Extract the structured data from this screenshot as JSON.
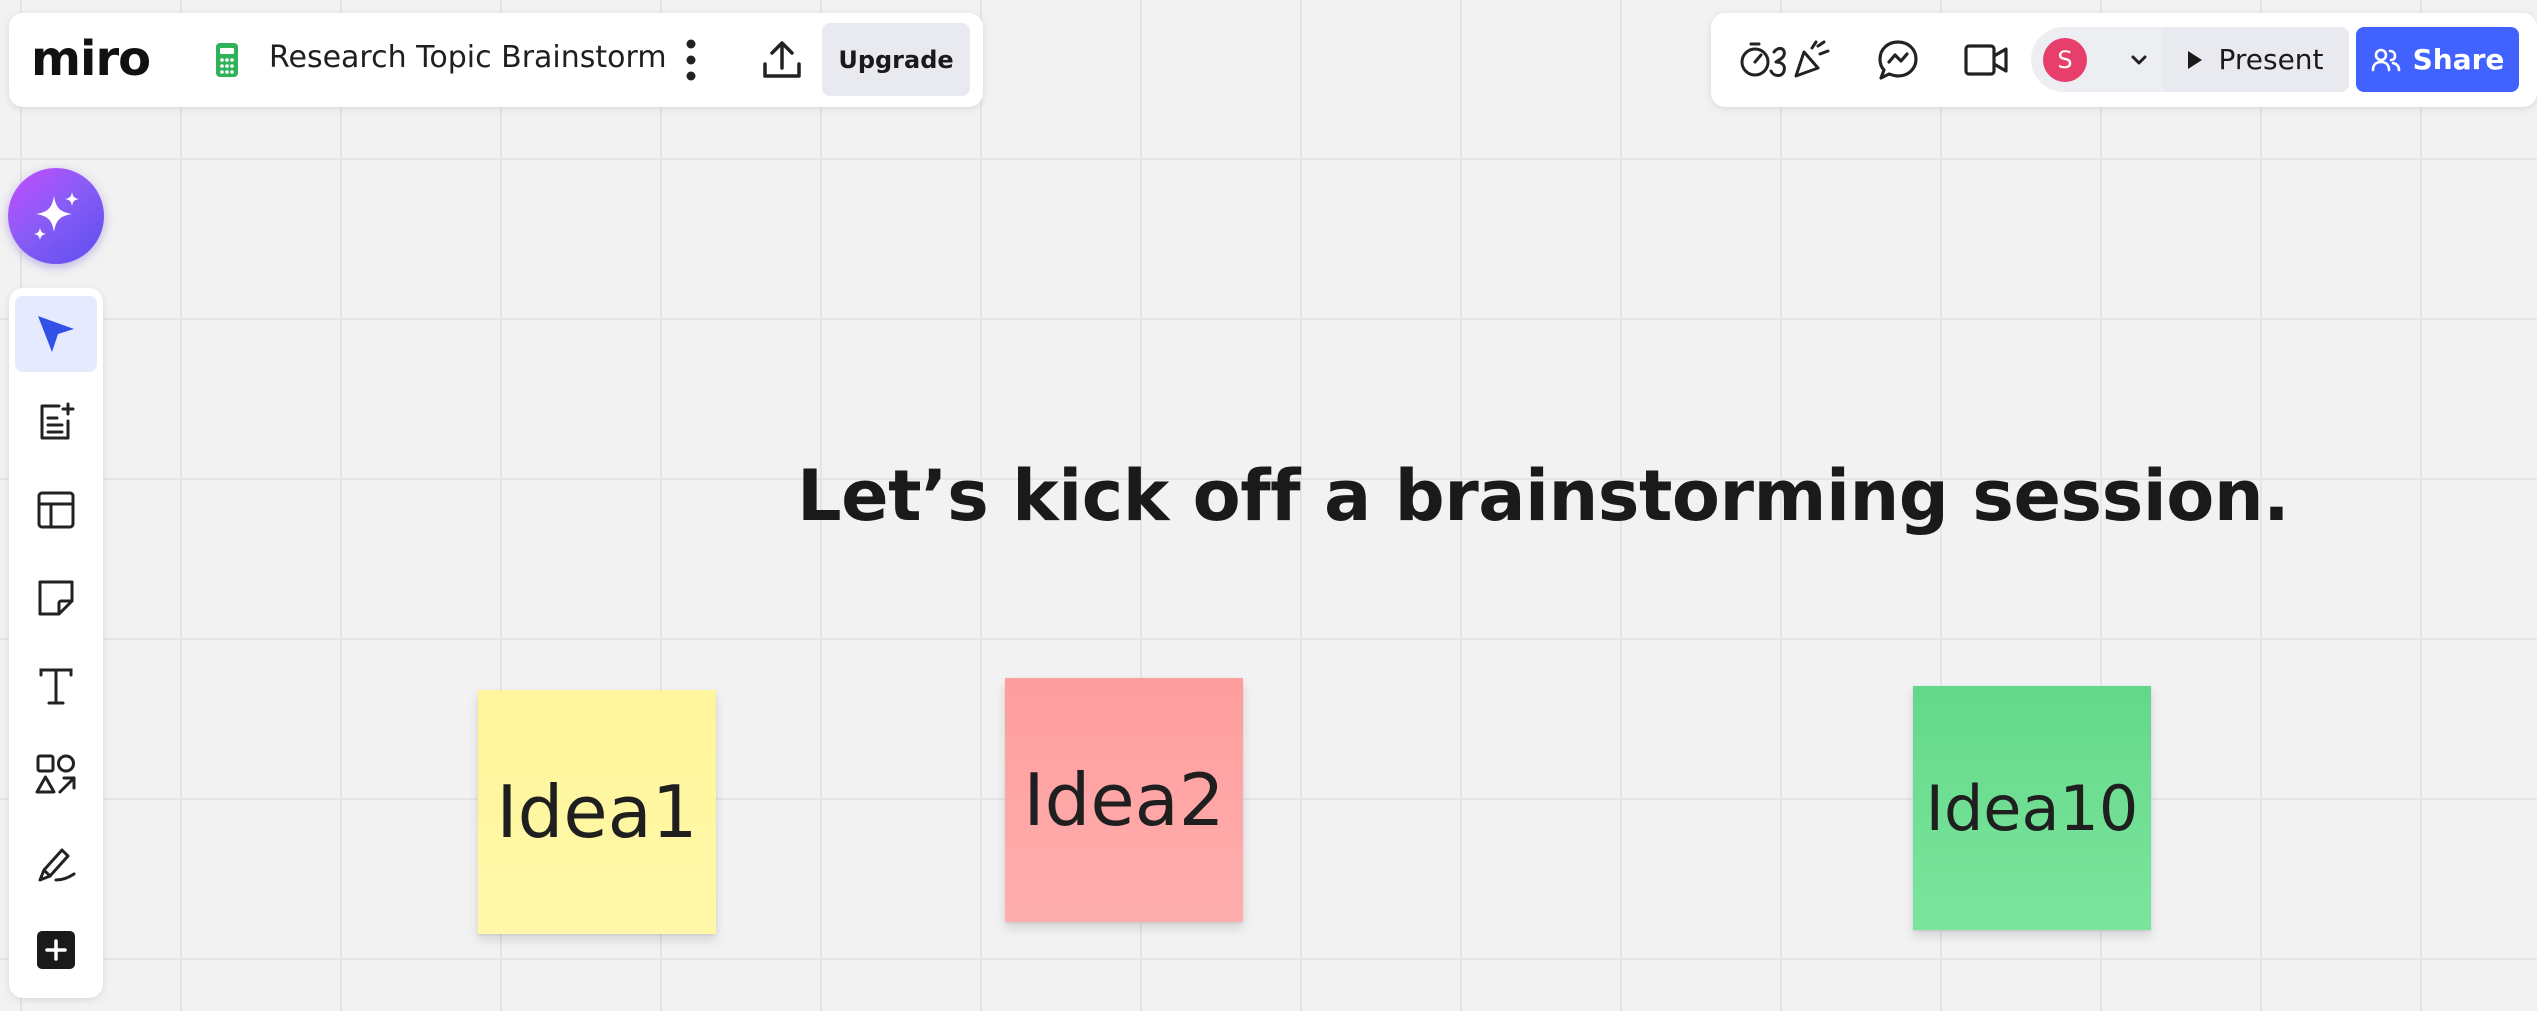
{
  "app": {
    "logo": "miro",
    "board_title": "Research Topic Brainstorm"
  },
  "toolbar_top": {
    "upgrade_label": "Upgrade",
    "present_label": "Present",
    "share_label": "Share",
    "avatar_initial": "S",
    "icons": [
      "board-icon",
      "more-vertical-icon",
      "export-icon",
      "timer-reactions-icon",
      "chat-icon",
      "video-icon",
      "chevron-down-icon",
      "play-icon",
      "users-icon"
    ]
  },
  "left_toolbar": {
    "tools": [
      "select-tool",
      "templates-tool",
      "frame-tool",
      "sticky-note-tool",
      "text-tool",
      "shapes-tool",
      "pen-tool",
      "more-apps-tool"
    ],
    "active_tool": "select-tool"
  },
  "canvas": {
    "headline": "Let’s kick off a brainstorming session.",
    "stickies": [
      {
        "text": "Idea1",
        "color": "#fff59c"
      },
      {
        "text": "Idea2",
        "color": "#ffa3a3"
      },
      {
        "text": "Idea10",
        "color": "#6fdf92"
      }
    ]
  },
  "colors": {
    "brand_blue": "#4262ff",
    "avatar": "#e83e6c",
    "canvas_bg": "#f2f2f2",
    "ai_gradient_start": "#c44dff",
    "ai_gradient_end": "#5b4ef0"
  }
}
